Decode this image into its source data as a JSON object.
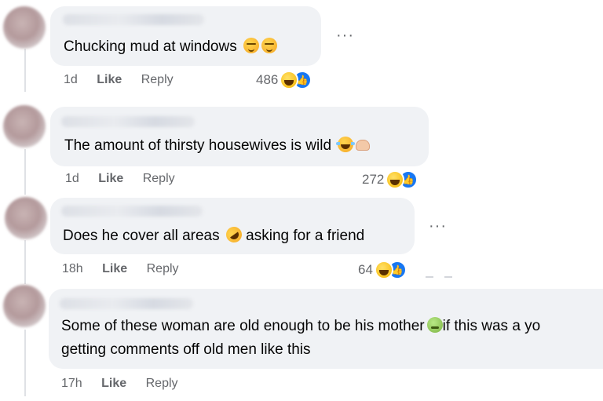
{
  "comments": [
    {
      "text": "Chucking mud at windows",
      "emojis": [
        "smirking-face",
        "smirking-face"
      ],
      "time": "1d",
      "like_label": "Like",
      "reply_label": "Reply",
      "reaction_count": "486",
      "reactions": [
        "haha",
        "like"
      ]
    },
    {
      "text": "The amount of thirsty housewives is wild",
      "emojis": [
        "face-with-tears-of-joy",
        "raised-hands"
      ],
      "time": "1d",
      "like_label": "Like",
      "reply_label": "Reply",
      "reaction_count": "272",
      "reactions": [
        "haha",
        "like"
      ]
    },
    {
      "text_before": "Does he cover all areas",
      "text_after": "asking for a friend",
      "emojis": [
        "rolling-on-floor-laughing"
      ],
      "time": "18h",
      "like_label": "Like",
      "reply_label": "Reply",
      "reaction_count": "64",
      "reactions": [
        "haha",
        "like"
      ]
    },
    {
      "line1_before": "Some of these woman are old enough to be his mother",
      "line1_after": "if this was a yo",
      "line2": "getting comments off old men like this",
      "emojis": [
        "nauseated-face"
      ],
      "time": "17h",
      "like_label": "Like",
      "reply_label": "Reply"
    }
  ],
  "more_options_label": "···",
  "colors": {
    "bubble": "#f0f2f5",
    "meta_text": "#65676b",
    "like_blue": "#1877f2"
  }
}
